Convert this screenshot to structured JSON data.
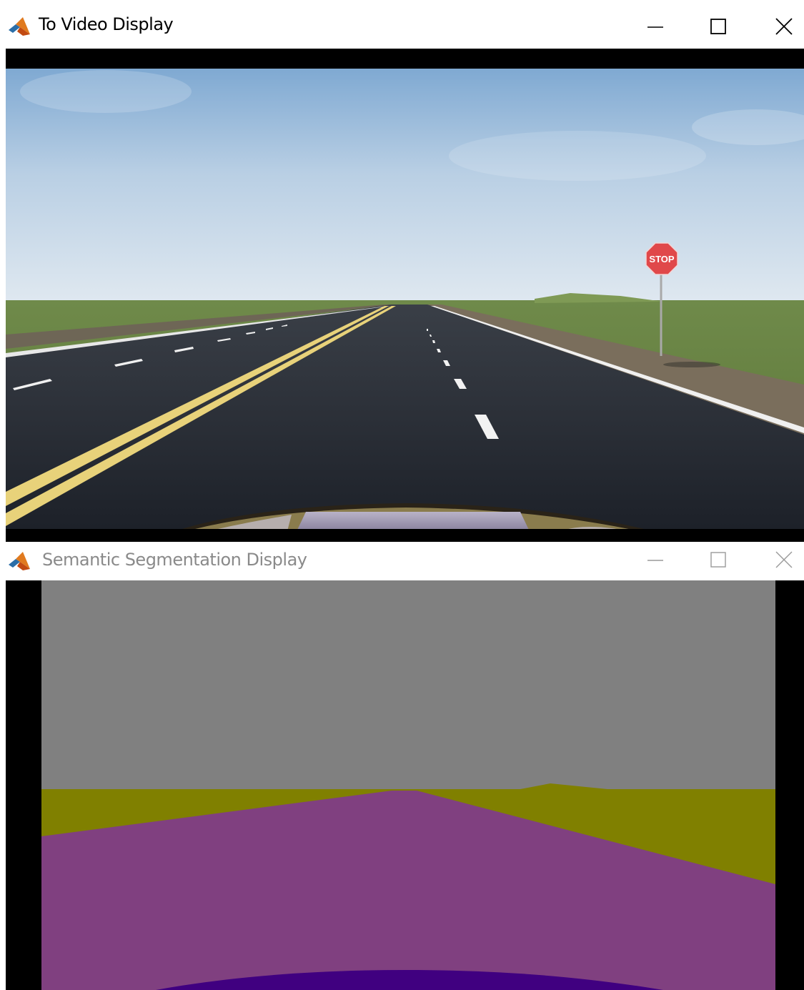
{
  "window1": {
    "title": "To Video Display",
    "icon": "matlab-logo-icon",
    "controls": [
      "minimize-icon",
      "maximize-icon",
      "close-icon"
    ],
    "sign_text": "STOP"
  },
  "window2": {
    "title": "Semantic Segmentation Display",
    "icon": "matlab-logo-icon",
    "controls": [
      "minimize-icon",
      "maximize-icon",
      "close-icon"
    ],
    "colors": {
      "sky": "#808080",
      "terrain": "#808000",
      "road": "#804080",
      "vehicle": "#400080",
      "letterbox": "#000000"
    }
  }
}
